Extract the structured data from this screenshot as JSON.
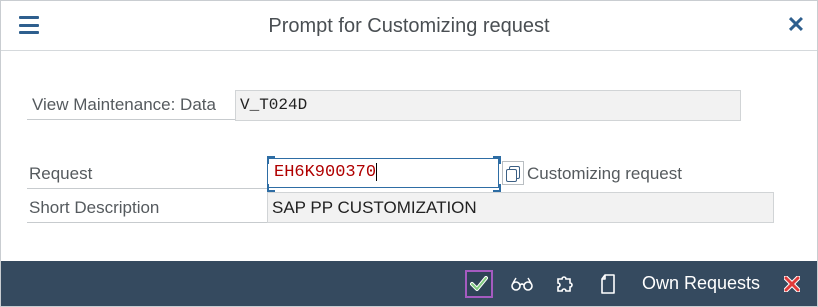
{
  "dialog": {
    "title": "Prompt for Customizing request",
    "menu_icon": "hamburger-menu-icon",
    "close_icon": "close-icon"
  },
  "form": {
    "view_label": "View Maintenance: Data",
    "view_value": "V_T024D",
    "request_label": "Request",
    "request_value": "EH6K900370",
    "request_type_text": "Customizing request",
    "short_desc_label": "Short Description",
    "short_desc_value": "SAP PP CUSTOMIZATION",
    "copy_icon": "copy-icon"
  },
  "footer": {
    "ok_icon": "checkmark-icon",
    "display_icon": "glasses-icon",
    "create_icon": "puzzle-icon",
    "new_icon": "document-icon",
    "own_requests_label": "Own Requests",
    "cancel_icon": "cancel-x-icon"
  },
  "colors": {
    "accent": "#2e5f8e",
    "footer_bg": "#354a5f",
    "request_text": "#b00000",
    "cancel": "#e03a3a",
    "ok_border": "#a55bc0",
    "ok_check": "#7ec87e"
  }
}
